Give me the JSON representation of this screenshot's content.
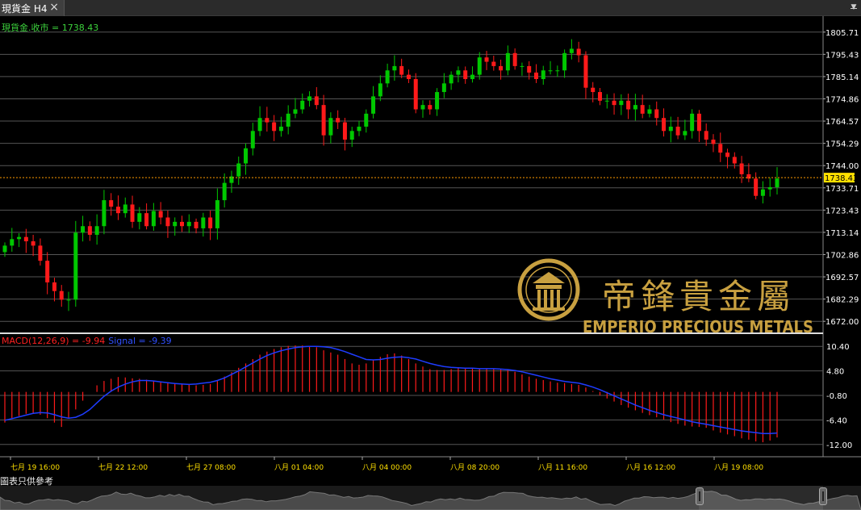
{
  "tab": {
    "title": "現貨金 H4",
    "close": "×",
    "menu": "▼"
  },
  "price_label": "現貨金.收市 = 1738.43",
  "current_price": 1738.43,
  "price_axis_labels": [
    "1805.71",
    "1795.43",
    "1785.14",
    "1774.86",
    "1764.57",
    "1754.29",
    "1744.00",
    "1733.71",
    "1723.43",
    "1713.14",
    "1702.86",
    "1692.57",
    "1682.29",
    "1672.00"
  ],
  "current_price_label": "1738.43",
  "macd_label": {
    "main": "MACD(12,26,9) = -9.94",
    "signal": "Signal = -9.39"
  },
  "macd_axis_labels": [
    "10.40",
    "4.80",
    "-0.80",
    "-6.40",
    "-12.00"
  ],
  "time_labels": [
    "七月 19 16:00",
    "七月 22 12:00",
    "七月 27 08:00",
    "八月 01 04:00",
    "八月 04 00:00",
    "八月 08 20:00",
    "八月 11 16:00",
    "八月 16 12:00",
    "八月 19 08:00"
  ],
  "watermark": {
    "chinese": "帝鋒貴金屬",
    "english": "EMPERIO PRECIOUS METALS"
  },
  "footer_note": "圖表只供參考",
  "colors": {
    "up": "#00c800",
    "down": "#ff1a1a",
    "grid": "#555555",
    "price_line": "#ff9900",
    "signal": "#1e3cff",
    "macd_hist": "#ff1a1a",
    "gold": "#c8a040",
    "label_green": "#3cd23c",
    "axis_text": "#ffffff",
    "time_text": "#ffe000"
  },
  "chart_data": {
    "type": "candlestick",
    "close_path": [
      1707,
      1710,
      1711,
      1709,
      1707,
      1700,
      1690,
      1686,
      1682,
      1682,
      1713,
      1716,
      1712,
      1716,
      1728,
      1725,
      1722,
      1726,
      1718,
      1722,
      1716,
      1723,
      1720,
      1716,
      1718,
      1716,
      1718,
      1715,
      1720,
      1715,
      1728,
      1736,
      1739,
      1745,
      1752,
      1760,
      1766,
      1764,
      1760,
      1762,
      1768,
      1770,
      1774,
      1776,
      1772,
      1758,
      1766,
      1764,
      1756,
      1760,
      1762,
      1768,
      1776,
      1782,
      1788,
      1790,
      1786,
      1784,
      1770,
      1772,
      1770,
      1778,
      1782,
      1786,
      1788,
      1784,
      1786,
      1794,
      1792,
      1790,
      1788,
      1796,
      1790,
      1790,
      1787,
      1784,
      1788,
      1788,
      1788,
      1796,
      1798,
      1795,
      1780,
      1778,
      1774,
      1774,
      1772,
      1774,
      1770,
      1772,
      1768,
      1770,
      1766,
      1760,
      1762,
      1758,
      1760,
      1768,
      1760,
      1756,
      1754,
      1750,
      1748,
      1745,
      1740,
      1738,
      1730,
      1733,
      1734,
      1738
    ],
    "macd_hist": [
      -7,
      -6,
      -5.5,
      -5,
      -4.8,
      -5.2,
      -6,
      -7,
      -8,
      -6,
      -4,
      -2,
      0,
      1.5,
      2.5,
      3,
      3.4,
      3.3,
      3.1,
      3,
      2.8,
      2.6,
      2.4,
      2.2,
      2,
      1.8,
      1.6,
      1.5,
      1.6,
      1.8,
      2.5,
      3.5,
      4.5,
      5.5,
      6.5,
      7.5,
      8.5,
      9.2,
      9.8,
      10.2,
      10.5,
      10.6,
      10.6,
      10.5,
      10.2,
      9.5,
      9,
      8.5,
      7.5,
      6.5,
      6.2,
      6.5,
      7.3,
      8,
      8.6,
      8.8,
      8.3,
      7.5,
      6.5,
      5.8,
      5.2,
      5,
      5,
      5.2,
      5.4,
      5.4,
      5.3,
      5.3,
      5.4,
      5.3,
      5.2,
      5,
      4.6,
      4,
      3.5,
      3,
      2.7,
      2.4,
      2.1,
      2,
      1.8,
      1.6,
      1,
      0.2,
      -0.8,
      -1.5,
      -2.2,
      -3,
      -3.6,
      -4.2,
      -4.8,
      -5.3,
      -5.8,
      -6.3,
      -6.9,
      -7.3,
      -7.7,
      -7.9,
      -8,
      -8.2,
      -8.8,
      -9.3,
      -9.7,
      -10.1,
      -10.6,
      -10.9,
      -11.3,
      -11.5,
      -11.1,
      -10.4
    ],
    "macd_signal": [
      -6.5,
      -6.1,
      -5.7,
      -5.3,
      -4.9,
      -4.7,
      -4.8,
      -5.2,
      -5.7,
      -6,
      -5.8,
      -5.1,
      -4,
      -2.5,
      -1,
      0.2,
      1.1,
      1.8,
      2.3,
      2.6,
      2.6,
      2.5,
      2.3,
      2.1,
      1.9,
      1.8,
      1.7,
      1.8,
      2,
      2.2,
      2.6,
      3.2,
      4,
      4.8,
      5.7,
      6.6,
      7.5,
      8.3,
      8.9,
      9.4,
      9.8,
      10.1,
      10.3,
      10.4,
      10.4,
      10.3,
      10.1,
      9.7,
      9.2,
      8.6,
      8,
      7.4,
      7.3,
      7.4,
      7.7,
      7.9,
      8,
      7.8,
      7.5,
      7,
      6.5,
      6.1,
      5.8,
      5.6,
      5.5,
      5.4,
      5.4,
      5.3,
      5.3,
      5.3,
      5.2,
      5.1,
      4.9,
      4.6,
      4.2,
      3.8,
      3.4,
      3,
      2.7,
      2.4,
      2.2,
      2,
      1.6,
      1.1,
      0.5,
      -0.2,
      -0.9,
      -1.6,
      -2.3,
      -3,
      -3.6,
      -4.2,
      -4.7,
      -5.2,
      -5.6,
      -6,
      -6.4,
      -6.8,
      -7.1,
      -7.4,
      -7.7,
      -8,
      -8.3,
      -8.6,
      -8.9,
      -9.1,
      -9.3,
      -9.5,
      -9.5,
      -9.39
    ]
  }
}
